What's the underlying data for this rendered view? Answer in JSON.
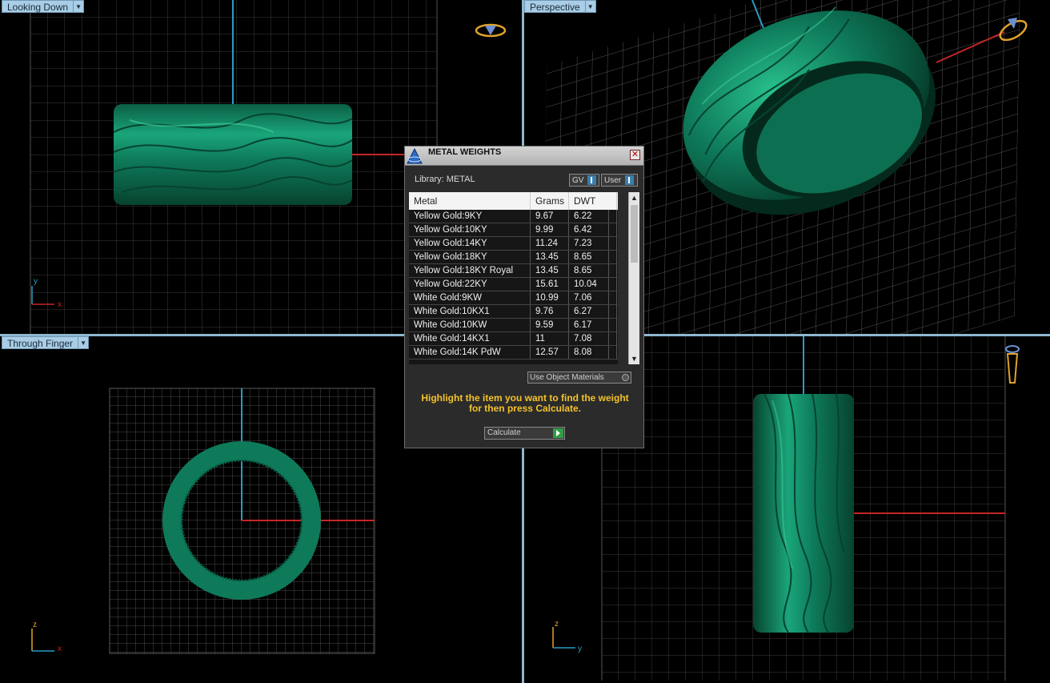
{
  "viewports": {
    "top_left": {
      "label": "Looking Down",
      "axis_y": "y",
      "axis_x": "x"
    },
    "top_right": {
      "label": "Perspective"
    },
    "bottom_left": {
      "label": "Through Finger",
      "axis_y": "z",
      "axis_x": "x"
    },
    "bottom_right": {
      "label": "",
      "axis_y": "z",
      "axis_x": "y"
    }
  },
  "dialog": {
    "title": "METAL WEIGHTS",
    "close_icon": "close-icon",
    "library_label": "Library: METAL",
    "toggle_gv": "GV",
    "toggle_user": "User",
    "columns": [
      "Metal",
      "Grams",
      "DWT"
    ],
    "rows": [
      {
        "metal": "Yellow Gold:9KY",
        "grams": "9.67",
        "dwt": "6.22"
      },
      {
        "metal": "Yellow Gold:10KY",
        "grams": "9.99",
        "dwt": "6.42"
      },
      {
        "metal": "Yellow Gold:14KY",
        "grams": "11.24",
        "dwt": "7.23"
      },
      {
        "metal": "Yellow Gold:18KY",
        "grams": "13.45",
        "dwt": "8.65"
      },
      {
        "metal": "Yellow Gold:18KY Royal",
        "grams": "13.45",
        "dwt": "8.65"
      },
      {
        "metal": "Yellow Gold:22KY",
        "grams": "15.61",
        "dwt": "10.04"
      },
      {
        "metal": "White Gold:9KW",
        "grams": "10.99",
        "dwt": "7.06"
      },
      {
        "metal": "White Gold:10KX1",
        "grams": "9.76",
        "dwt": "6.27"
      },
      {
        "metal": "White Gold:10KW",
        "grams": "9.59",
        "dwt": "6.17"
      },
      {
        "metal": "White Gold:14KX1",
        "grams": "11",
        "dwt": "7.08"
      },
      {
        "metal": "White Gold:14K PdW",
        "grams": "12.57",
        "dwt": "8.08"
      }
    ],
    "use_object_materials": "Use Object Materials",
    "hint": "Highlight the item you want to find the weight for then press Calculate.",
    "calculate_label": "Calculate"
  },
  "colors": {
    "ring": "#0e7a5a",
    "grid": "#3c3c3c",
    "axis_blue": "#2a9cc4",
    "axis_red": "#c42626",
    "viewport_frame": "#8fb7cf",
    "hint": "#f4c22a"
  }
}
